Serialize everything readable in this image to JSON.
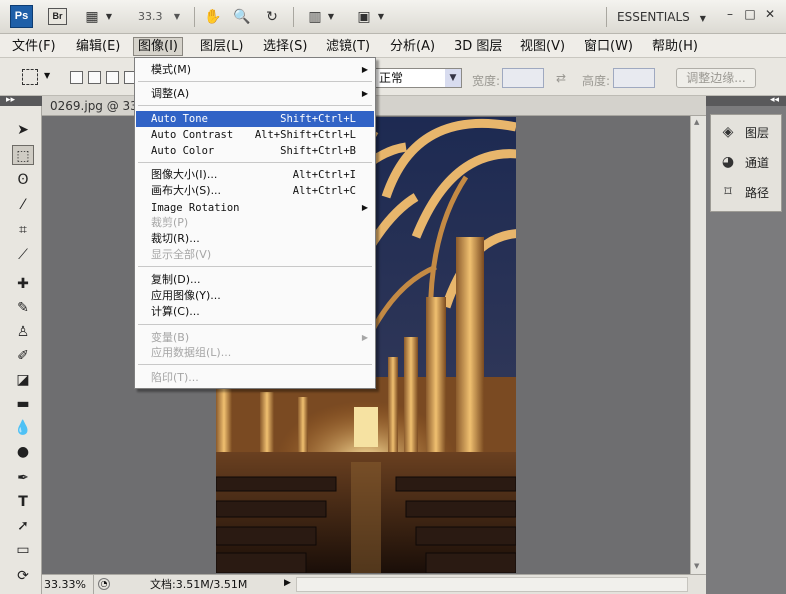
{
  "app": {
    "logo": "Ps",
    "bridge": "Br",
    "zoom": "33.3",
    "workspace": "ESSENTIALS"
  },
  "menubar": [
    {
      "label": "文件(F)"
    },
    {
      "label": "编辑(E)"
    },
    {
      "label": "图像(I)"
    },
    {
      "label": "图层(L)"
    },
    {
      "label": "选择(S)"
    },
    {
      "label": "滤镜(T)"
    },
    {
      "label": "分析(A)"
    },
    {
      "label": "3D 图层"
    },
    {
      "label": "视图(V)"
    },
    {
      "label": "窗口(W)"
    },
    {
      "label": "帮助(H)"
    }
  ],
  "options": {
    "mode_value": "正常",
    "width_label": "宽度:",
    "height_label": "高度:",
    "refine_label": "调整边缘..."
  },
  "document": {
    "tab_label": "0269.jpg @ 33",
    "zoom_status": "33.33%",
    "doc_size": "文档:3.51M/3.51M"
  },
  "panels": [
    {
      "label": "图层",
      "icon": "layers-icon"
    },
    {
      "label": "通道",
      "icon": "channels-icon"
    },
    {
      "label": "路径",
      "icon": "paths-icon"
    }
  ],
  "image_menu": {
    "items": [
      {
        "label": "模式(M)",
        "shortcut": "",
        "submenu": true,
        "disabled": false
      },
      {
        "label": "调整(A)",
        "shortcut": "",
        "submenu": true,
        "disabled": false
      },
      {
        "label": "Auto Tone",
        "shortcut": "Shift+Ctrl+L",
        "submenu": false,
        "disabled": false,
        "highlighted": true
      },
      {
        "label": "Auto Contrast",
        "shortcut": "Alt+Shift+Ctrl+L",
        "submenu": false,
        "disabled": false
      },
      {
        "label": "Auto Color",
        "shortcut": "Shift+Ctrl+B",
        "submenu": false,
        "disabled": false
      },
      {
        "label": "图像大小(I)...",
        "shortcut": "Alt+Ctrl+I",
        "submenu": false,
        "disabled": false
      },
      {
        "label": "画布大小(S)...",
        "shortcut": "Alt+Ctrl+C",
        "submenu": false,
        "disabled": false
      },
      {
        "label": "Image Rotation",
        "shortcut": "",
        "submenu": true,
        "disabled": false
      },
      {
        "label": "裁剪(P)",
        "shortcut": "",
        "submenu": false,
        "disabled": true
      },
      {
        "label": "裁切(R)...",
        "shortcut": "",
        "submenu": false,
        "disabled": false
      },
      {
        "label": "显示全部(V)",
        "shortcut": "",
        "submenu": false,
        "disabled": true
      },
      {
        "label": "复制(D)...",
        "shortcut": "",
        "submenu": false,
        "disabled": false
      },
      {
        "label": "应用图像(Y)...",
        "shortcut": "",
        "submenu": false,
        "disabled": false
      },
      {
        "label": "计算(C)...",
        "shortcut": "",
        "submenu": false,
        "disabled": false
      },
      {
        "label": "变量(B)",
        "shortcut": "",
        "submenu": true,
        "disabled": true
      },
      {
        "label": "应用数据组(L)...",
        "shortcut": "",
        "submenu": false,
        "disabled": true
      },
      {
        "label": "陷印(T)...",
        "shortcut": "",
        "submenu": false,
        "disabled": true
      }
    ]
  }
}
